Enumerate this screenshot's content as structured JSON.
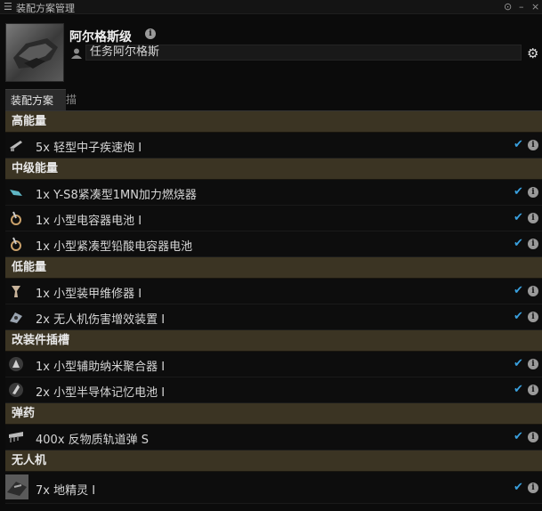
{
  "window": {
    "title": "装配方案管理",
    "menu_icon": "hamburger-icon",
    "controls": [
      "info-circle-icon",
      "close-icon"
    ]
  },
  "ship": {
    "name": "阿尔格斯级",
    "fitting_name": "任务阿尔格斯"
  },
  "tabs": [
    {
      "label": "装配方案",
      "active": true
    },
    {
      "label": "描述",
      "active": false
    }
  ],
  "colors": {
    "section_bg": "#3b3423",
    "check": "#39a0de"
  },
  "sections": [
    {
      "title": "高能量",
      "items": [
        {
          "label": "5x 轻型中子疾速炮 I",
          "icon": "turret-icon"
        }
      ]
    },
    {
      "title": "中级能量",
      "items": [
        {
          "label": "1x Y-S8紧凑型1MN加力燃烧器",
          "icon": "afterburner-icon"
        },
        {
          "label": "1x 小型电容器电池 I",
          "icon": "capacitor-icon"
        },
        {
          "label": "1x 小型紧凑型铅酸电容器电池",
          "icon": "capacitor-icon"
        }
      ]
    },
    {
      "title": "低能量",
      "items": [
        {
          "label": "1x 小型装甲维修器 I",
          "icon": "armor-repairer-icon"
        },
        {
          "label": "2x 无人机伤害增效装置 I",
          "icon": "drone-damage-icon"
        }
      ]
    },
    {
      "title": "改装件插槽",
      "items": [
        {
          "label": "1x 小型辅助纳米聚合器 I",
          "icon": "rig-icon"
        },
        {
          "label": "2x 小型半导体记忆电池 I",
          "icon": "rig-icon"
        }
      ]
    },
    {
      "title": "弹药",
      "items": [
        {
          "label": "400x 反物质轨道弹 S",
          "icon": "ammo-icon"
        }
      ]
    },
    {
      "title": "无人机",
      "items": [
        {
          "label": "7x 地精灵 I",
          "icon": "drone-icon"
        }
      ]
    }
  ]
}
